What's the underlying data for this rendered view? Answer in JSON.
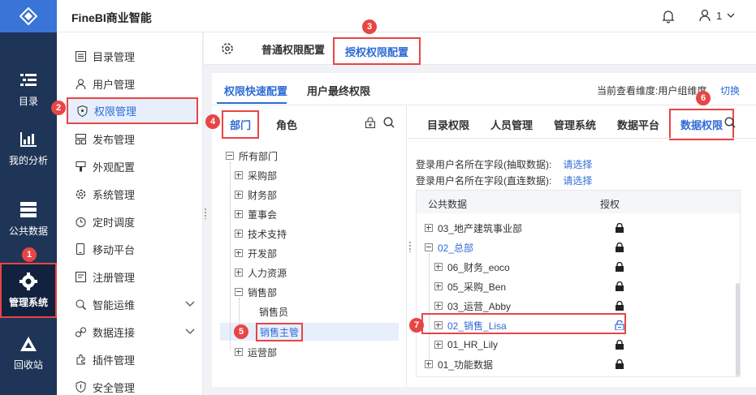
{
  "app": {
    "title": "FineBI商业智能",
    "user_name": "1"
  },
  "nav_rail": [
    {
      "label": "目录",
      "icon": "directory-icon"
    },
    {
      "label": "我的分析",
      "icon": "analysis-icon"
    },
    {
      "label": "公共数据",
      "icon": "public-data-icon"
    },
    {
      "label": "管理系统",
      "icon": "gear-icon",
      "active": true
    },
    {
      "label": "回收站",
      "icon": "recycle-icon"
    }
  ],
  "submenu": [
    {
      "label": "目录管理",
      "icon": "list-icon"
    },
    {
      "label": "用户管理",
      "icon": "user-icon"
    },
    {
      "label": "权限管理",
      "icon": "shield-icon",
      "active": true
    },
    {
      "label": "发布管理",
      "icon": "publish-icon"
    },
    {
      "label": "外观配置",
      "icon": "appearance-icon"
    },
    {
      "label": "系统管理",
      "icon": "settings-icon"
    },
    {
      "label": "定时调度",
      "icon": "timer-icon"
    },
    {
      "label": "移动平台",
      "icon": "mobile-icon"
    },
    {
      "label": "注册管理",
      "icon": "register-icon"
    },
    {
      "label": "智能运维",
      "icon": "ops-icon",
      "expandable": true
    },
    {
      "label": "数据连接",
      "icon": "link-icon",
      "expandable": true
    },
    {
      "label": "插件管理",
      "icon": "plugin-icon"
    },
    {
      "label": "安全管理",
      "icon": "security-icon"
    }
  ],
  "main_tabs": {
    "normal": "普通权限配置",
    "grant": "授权权限配置"
  },
  "sub_tabs": {
    "quick": "权限快速配置",
    "final": "用户最终权限"
  },
  "dimension": {
    "info": "当前查看维度:用户组维度",
    "switch": "切换"
  },
  "left_tabs": {
    "dept": "部门",
    "role": "角色"
  },
  "tree": {
    "root": "所有部门",
    "items": [
      "采购部",
      "财务部",
      "董事会",
      "技术支持",
      "开发部",
      "人力资源",
      "销售部"
    ],
    "sales_children": [
      "销售员",
      "销售主管"
    ],
    "last": "运营部"
  },
  "right_tabs": [
    "目录权限",
    "人员管理",
    "管理系统",
    "数据平台",
    "数据权限"
  ],
  "fields": [
    {
      "label": "登录用户名所在字段(抽取数据):",
      "link": "请选择"
    },
    {
      "label": "登录用户名所在字段(直连数据):",
      "link": "请选择"
    }
  ],
  "grid": {
    "col_data": "公共数据",
    "col_auth": "授权",
    "rows": [
      "03_地产建筑事业部",
      "02_总部",
      "06_财务_eoco",
      "05_采购_Ben",
      "03_运营_Abby",
      "02_销售_Lisa",
      "01_HR_Lily",
      "01_功能数据"
    ]
  },
  "badges": [
    "1",
    "2",
    "3",
    "4",
    "5",
    "6",
    "7"
  ],
  "colors": {
    "accent": "#2e6bd6",
    "nav_bg": "#1f3557",
    "highlight_border": "#e84545"
  }
}
